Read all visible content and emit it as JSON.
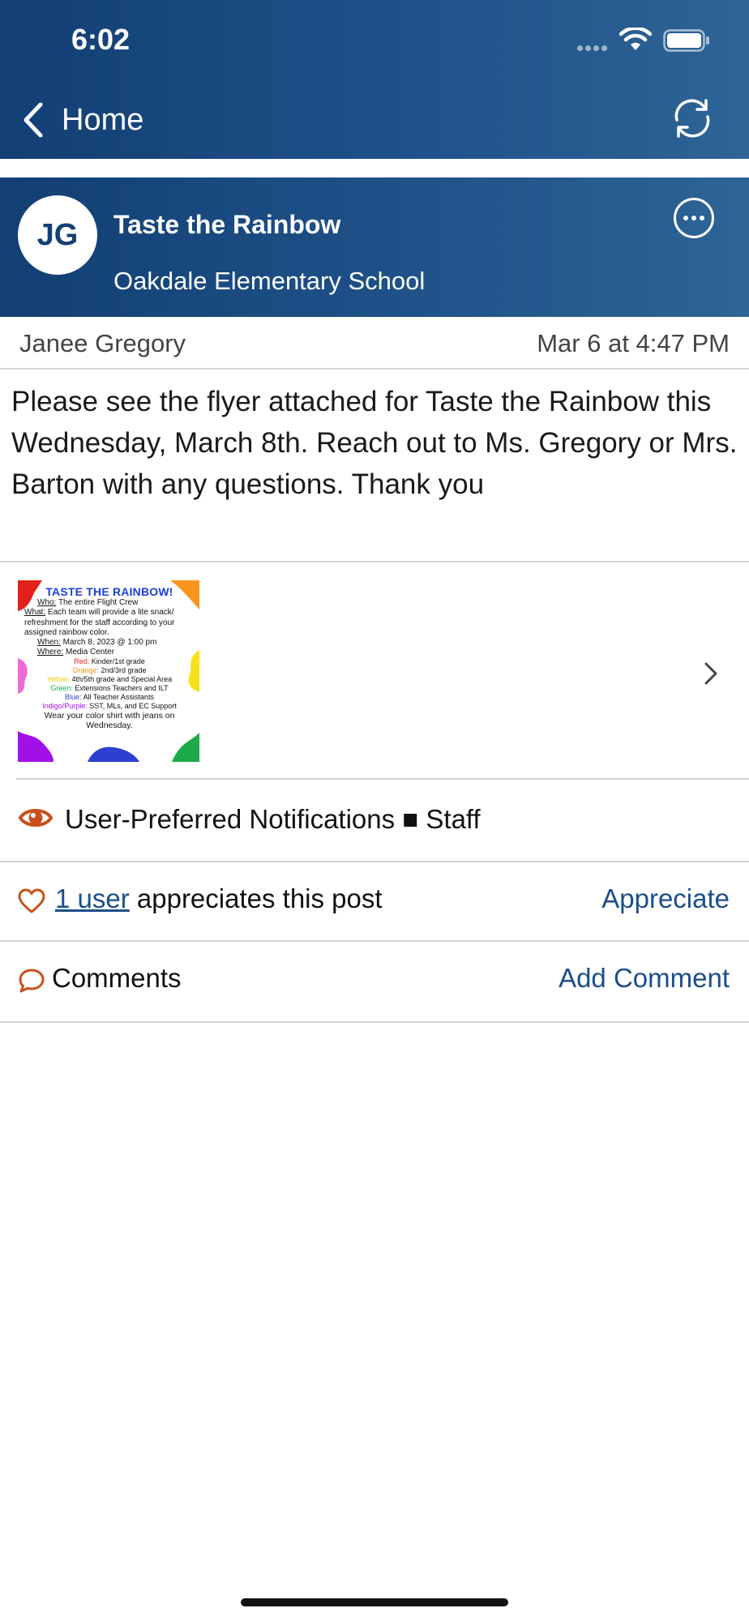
{
  "status_bar": {
    "time": "6:02"
  },
  "nav": {
    "back_label": "Home",
    "back_icon": "chevron-left-icon",
    "refresh_icon": "refresh-icon"
  },
  "post": {
    "avatar_initials": "JG",
    "title": "Taste the Rainbow",
    "school": "Oakdale Elementary School",
    "author": "Janee Gregory",
    "date": "Mar 6 at 4:47 PM",
    "body": "Please see the flyer attached for Taste the Rainbow this Wednesday, March 8th. Reach out to Ms. Gregory or Mrs. Barton with any questions. Thank you"
  },
  "attachment": {
    "flyer": {
      "title": "TASTE THE RAINBOW!",
      "who_label": "Who:",
      "who": " The entire Flight Crew",
      "what_label": "What:",
      "what": " Each team will provide a lite snack/ refreshment for the staff according to your assigned rainbow color.",
      "when_label": "When:",
      "when": " March 8, 2023 @ 1:00 pm",
      "where_label": "Where:",
      "where": " Media Center",
      "red_label": "Red:",
      "red": " Kinder/1st grade",
      "orange_label": "Orange:",
      "orange": " 2nd/3rd grade",
      "yellow_label": "Yellow:",
      "yellow": " 4th/5th grade and Special Area",
      "green_label": "Green:",
      "green": " Extensions Teachers and ILT",
      "blue_label": "Blue:",
      "blue": " All Teacher Assistants",
      "purple_label": "Indigo/Purple:",
      "purple": " SST, MLs, and EC Support",
      "closing": "Wear your color shirt with jeans on Wednesday."
    }
  },
  "notifications": {
    "text": "User-Preferred Notifications ■ Staff"
  },
  "appreciation": {
    "user_link": "1 user",
    "text": " appreciates this post",
    "button": "Appreciate"
  },
  "comments": {
    "label": "Comments",
    "button": "Add Comment"
  },
  "colors": {
    "header_dark": "#123f74",
    "header_light": "#2e6496",
    "accent_link": "#1b4f8a",
    "icon_orange": "#c8501a",
    "divider": "#d3d3d3"
  }
}
